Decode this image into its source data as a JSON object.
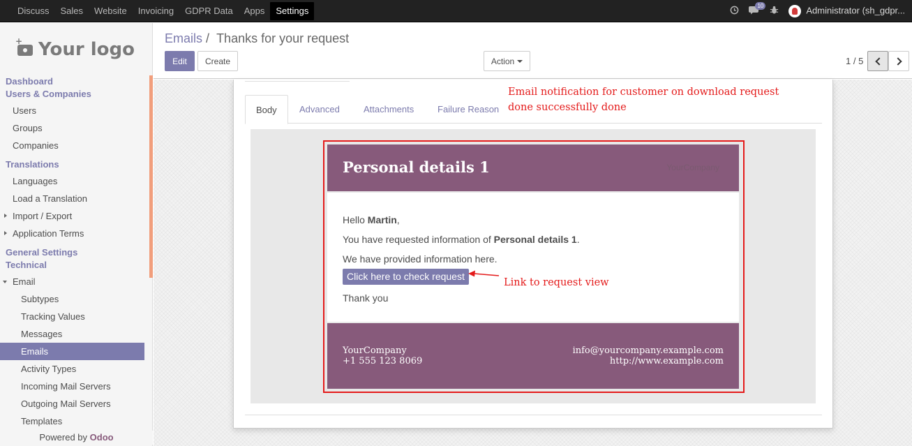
{
  "topbar": {
    "menu": [
      "Discuss",
      "Sales",
      "Website",
      "Invoicing",
      "GDPR Data",
      "Apps",
      "Settings"
    ],
    "active": "Settings",
    "notif_count": "10",
    "user": "Administrator (sh_gdpr..."
  },
  "sidebar": {
    "logo_text": "Your logo",
    "items": [
      {
        "label": "Dashboard",
        "kind": "section"
      },
      {
        "label": "Users & Companies",
        "kind": "section"
      },
      {
        "label": "Users",
        "kind": "item"
      },
      {
        "label": "Groups",
        "kind": "item"
      },
      {
        "label": "Companies",
        "kind": "item"
      },
      {
        "label": "Translations",
        "kind": "section"
      },
      {
        "label": "Languages",
        "kind": "item"
      },
      {
        "label": "Load a Translation",
        "kind": "item"
      },
      {
        "label": "Import / Export",
        "kind": "item-caret"
      },
      {
        "label": "Application Terms",
        "kind": "item-caret"
      },
      {
        "label": "General Settings",
        "kind": "section"
      },
      {
        "label": "Technical",
        "kind": "section"
      },
      {
        "label": "Email",
        "kind": "item-open"
      },
      {
        "label": "Subtypes",
        "kind": "sub"
      },
      {
        "label": "Tracking Values",
        "kind": "sub"
      },
      {
        "label": "Messages",
        "kind": "sub"
      },
      {
        "label": "Emails",
        "kind": "sub-active"
      },
      {
        "label": "Activity Types",
        "kind": "sub"
      },
      {
        "label": "Incoming Mail Servers",
        "kind": "sub"
      },
      {
        "label": "Outgoing Mail Servers",
        "kind": "sub"
      },
      {
        "label": "Templates",
        "kind": "sub"
      }
    ],
    "powered_prefix": "Powered by ",
    "powered_brand": "Odoo"
  },
  "control_panel": {
    "breadcrumb_parent": "Emails",
    "breadcrumb_sep": "/",
    "breadcrumb_current": "Thanks for your request",
    "edit_label": "Edit",
    "create_label": "Create",
    "action_label": "Action",
    "pager": "1 / 5"
  },
  "tabs": [
    "Body",
    "Advanced",
    "Attachments",
    "Failure Reason"
  ],
  "active_tab": "Body",
  "annotations": {
    "top_line1": "Email notification for customer on download request",
    "top_line2": "done successfully done",
    "link": "Link to request view"
  },
  "email": {
    "title": "Personal details 1",
    "logo_alt": "YourCompany",
    "greeting_prefix": "Hello ",
    "greeting_name": "Martin",
    "greeting_suffix": ",",
    "line2_prefix": "You have requested information of ",
    "line2_bold": "Personal details 1",
    "line2_suffix": ".",
    "line3": "We have provided information here.",
    "button": "Click here to check request",
    "thanks": "Thank you",
    "footer_company": "YourCompany",
    "footer_phone": "+1 555 123 8069",
    "footer_email": "info@yourcompany.example.com",
    "footer_web": "http://www.example.com"
  },
  "colors": {
    "brand": "#7c7bad",
    "mail_header": "#875a7b",
    "annotation": "#e41a1a",
    "sidebar_scroll": "#f19e7c"
  }
}
